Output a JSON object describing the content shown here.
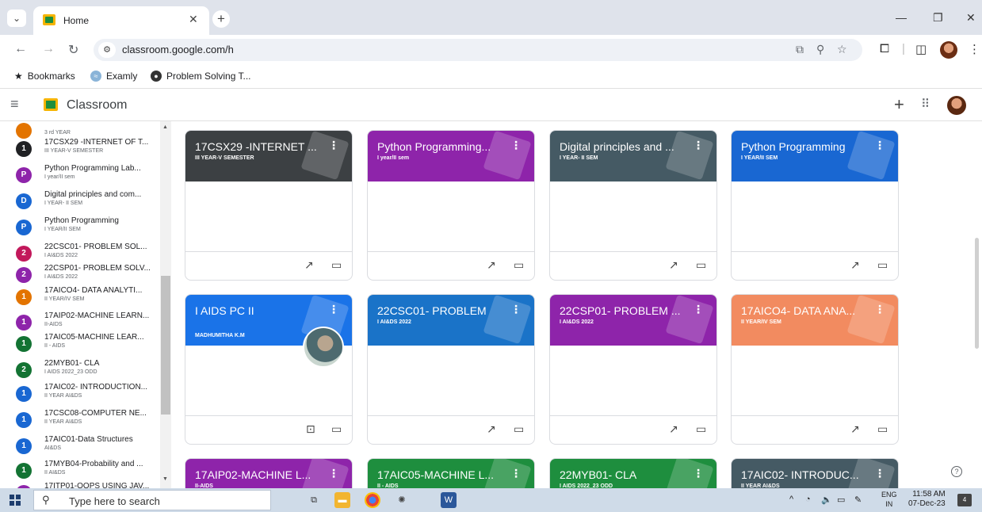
{
  "browser": {
    "tab_title": "Home",
    "url": "classroom.google.com/h",
    "bookmarks": [
      {
        "label": "Bookmarks",
        "icon": "star-icon"
      },
      {
        "label": "Examly",
        "icon": "examly-icon"
      },
      {
        "label": "Problem Solving T...",
        "icon": "problem-solving-icon"
      }
    ]
  },
  "app": {
    "title": "Classroom"
  },
  "sidebar": {
    "items": [
      {
        "initial": "",
        "name": "",
        "sub": "3 rd YEAR",
        "color": "#e37400"
      },
      {
        "initial": "1",
        "name": "17CSX29 -INTERNET OF T...",
        "sub": "III YEAR-V SEMESTER",
        "color": "#202124"
      },
      {
        "initial": "P",
        "name": "Python Programming Lab...",
        "sub": "I year/II sem",
        "color": "#8e24aa"
      },
      {
        "initial": "D",
        "name": "Digital principles and com...",
        "sub": "I YEAR- II SEM",
        "color": "#1967d2"
      },
      {
        "initial": "P",
        "name": "Python Programming",
        "sub": "I YEAR/II SEM",
        "color": "#1967d2"
      },
      {
        "initial": "2",
        "name": "22CSC01- PROBLEM SOL...",
        "sub": "I AI&DS 2022",
        "color": "#c2185b"
      },
      {
        "initial": "2",
        "name": "22CSP01- PROBLEM SOLV...",
        "sub": "I AI&DS 2022",
        "color": "#8e24aa"
      },
      {
        "initial": "1",
        "name": "17AICO4- DATA ANALYTI...",
        "sub": "II YEAR/IV SEM",
        "color": "#e37400"
      },
      {
        "initial": "1",
        "name": "17AIP02-MACHINE LEARN...",
        "sub": "II-AIDS",
        "color": "#8e24aa"
      },
      {
        "initial": "1",
        "name": "17AIC05-MACHINE LEAR...",
        "sub": "II - AIDS",
        "color": "#137333"
      },
      {
        "initial": "2",
        "name": "22MYB01- CLA",
        "sub": "I AIDS 2022_23 ODD",
        "color": "#137333"
      },
      {
        "initial": "1",
        "name": "17AIC02- INTRODUCTION...",
        "sub": "II YEAR AI&DS",
        "color": "#1967d2"
      },
      {
        "initial": "1",
        "name": "17CSC08-COMPUTER NE...",
        "sub": "II YEAR AI&DS",
        "color": "#1967d2"
      },
      {
        "initial": "1",
        "name": "17AIC01-Data Structures",
        "sub": "AI&DS",
        "color": "#1967d2"
      },
      {
        "initial": "1",
        "name": "17MYB04-Probability and ...",
        "sub": "II AI&DS",
        "color": "#137333"
      },
      {
        "initial": "",
        "name": "17ITP01-OOPS USING JAV...",
        "sub": "",
        "color": "#8e24aa"
      }
    ]
  },
  "cards": [
    {
      "title": "17CSX29 -INTERNET ...",
      "sub": "III YEAR-V SEMESTER",
      "color": "#3c4043",
      "owner": ""
    },
    {
      "title": "Python Programming...",
      "sub": "I year/II sem",
      "color": "#8e24aa",
      "owner": ""
    },
    {
      "title": "Digital principles and ...",
      "sub": "I YEAR- II SEM",
      "color": "#455a64",
      "owner": ""
    },
    {
      "title": "Python Programming",
      "sub": "I YEAR/II SEM",
      "color": "#1967d2",
      "owner": ""
    },
    {
      "title": "I AIDS PC II",
      "sub": "",
      "color": "#1a73e8",
      "owner": "MADHUMITHA K.M"
    },
    {
      "title": "22CSC01- PROBLEM",
      "sub": "I AI&DS 2022",
      "color": "#1a73c8",
      "owner": ""
    },
    {
      "title": "22CSP01- PROBLEM ...",
      "sub": "I AI&DS 2022",
      "color": "#8e24aa",
      "owner": ""
    },
    {
      "title": "17AICO4- DATA ANA...",
      "sub": "II YEAR/IV SEM",
      "color": "#f28b60",
      "owner": ""
    },
    {
      "title": "17AIP02-MACHINE L...",
      "sub": "II-AIDS",
      "color": "#8e24aa",
      "owner": ""
    },
    {
      "title": "17AIC05-MACHINE L...",
      "sub": "II - AIDS",
      "color": "#1e8e3e",
      "owner": ""
    },
    {
      "title": "22MYB01- CLA",
      "sub": "I AIDS 2022_23 ODD",
      "color": "#1e8e3e",
      "owner": ""
    },
    {
      "title": "17AIC02- INTRODUC...",
      "sub": "II YEAR AI&DS",
      "color": "#455a64",
      "owner": ""
    }
  ],
  "taskbar": {
    "search_placeholder": "Type here to search",
    "lang_top": "ENG",
    "lang_bottom": "IN",
    "time": "11:58 AM",
    "date": "07-Dec-23",
    "notification_count": "4"
  }
}
